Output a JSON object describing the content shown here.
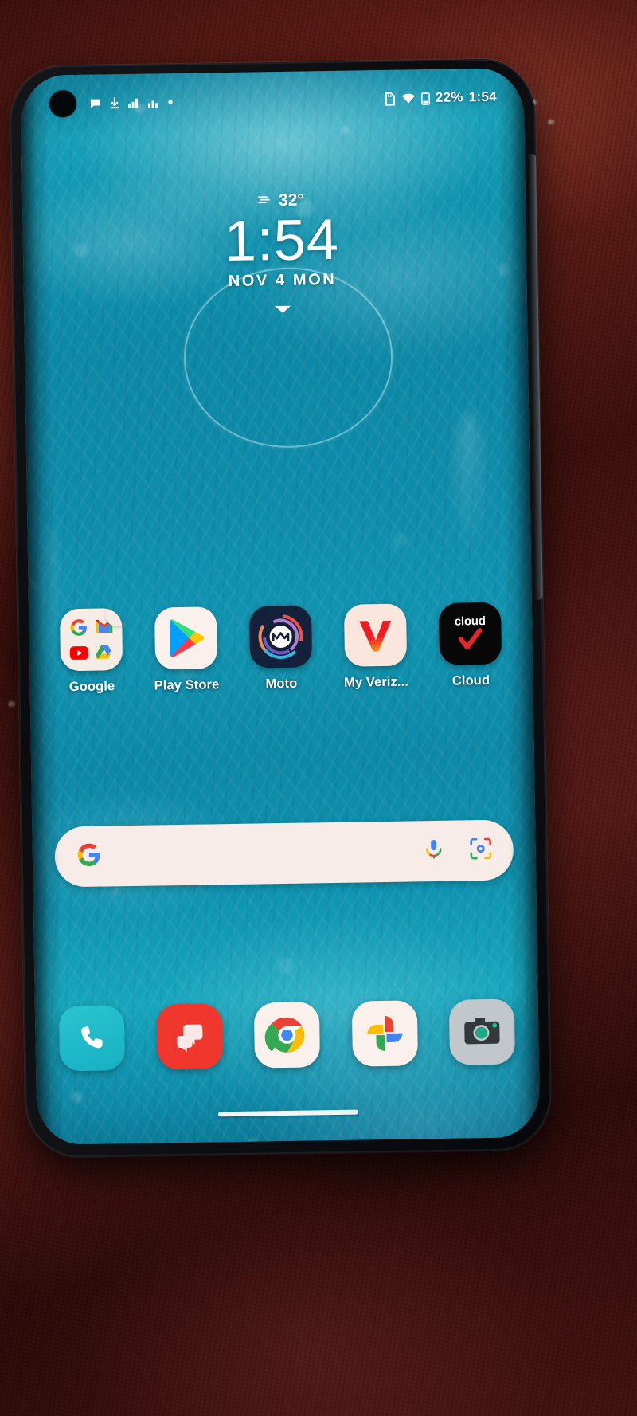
{
  "device": {
    "kind": "smartphone-photo",
    "screen_bg_color": "#0e8cab"
  },
  "status_bar": {
    "left_icons": [
      "message-bubble-icon",
      "download-icon",
      "signal-bars-icon",
      "signal-bars-secondary-icon",
      "dot-icon"
    ],
    "right_icons": [
      "sd-card-icon",
      "wifi-icon",
      "battery-icon"
    ],
    "battery_percent": "22%",
    "clock": "1:54"
  },
  "clock_widget": {
    "weather_icon": "fog-icon",
    "temperature": "32°",
    "time": "1:54",
    "date": "NOV  4  MON",
    "expand_icon": "chevron-down-icon"
  },
  "app_row": {
    "apps": [
      {
        "label": "Google",
        "icon": "google-folder-icon"
      },
      {
        "label": "Play Store",
        "icon": "play-store-icon"
      },
      {
        "label": "Moto",
        "icon": "moto-icon"
      },
      {
        "label": "My Veriz...",
        "icon": "my-verizon-icon"
      },
      {
        "label": "Cloud",
        "icon": "cloud-icon",
        "icon_text": "cloud"
      }
    ]
  },
  "search_bar": {
    "logo_icon": "google-g-icon",
    "placeholder": "",
    "value": "",
    "mic_icon": "microphone-icon",
    "lens_icon": "google-lens-icon"
  },
  "dock": {
    "apps": [
      {
        "label": "Phone",
        "icon": "phone-icon"
      },
      {
        "label": "Messages",
        "icon": "messages-icon"
      },
      {
        "label": "Chrome",
        "icon": "chrome-icon"
      },
      {
        "label": "Photos",
        "icon": "google-photos-icon"
      },
      {
        "label": "Camera",
        "icon": "camera-icon"
      }
    ]
  },
  "navigation": {
    "gesture_pill": "home-gesture-pill"
  },
  "colors": {
    "wallpaper_teal": "#0e8cab",
    "search_bar_bg": "#f7ece8",
    "verizon_red": "#ee1d25",
    "messages_red": "#f0372e",
    "phone_teal": "#1fb8c8",
    "moto_navy": "#14213a",
    "cloud_black": "#080808"
  }
}
